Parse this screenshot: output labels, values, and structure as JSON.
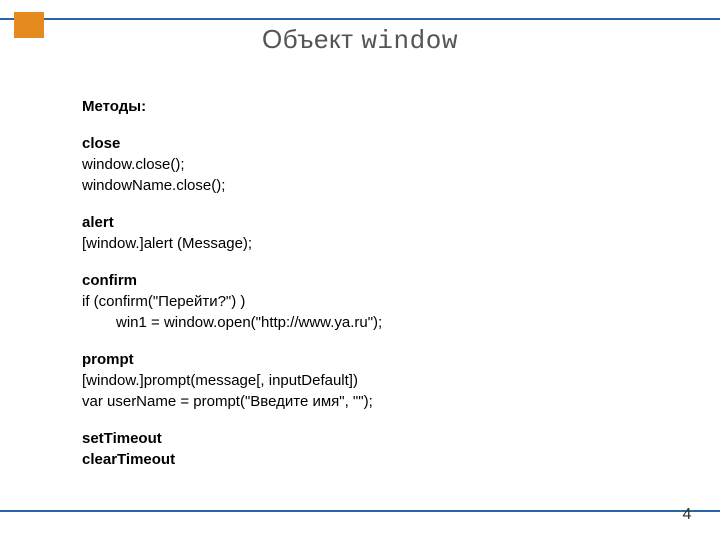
{
  "title_part1": "Объект ",
  "title_part2": "window",
  "lines": {
    "methods_heading": "Методы:",
    "close_h": "close",
    "close_l1": "window.close();",
    "close_l2": "windowName.close();",
    "alert_h": "alert",
    "alert_l1": "[window.]alert (Message);",
    "confirm_h": "confirm",
    "confirm_l1": "if (confirm(\"Перейти?\") )",
    "confirm_l2": "win1 = window.open(\"http://www.ya.ru\");",
    "prompt_h": "prompt",
    "prompt_l1": "[window.]prompt(message[, inputDefault])",
    "prompt_l2": "var userName = prompt(\"Введите имя\", \"\");",
    "settimeout_h": "setTimeout",
    "cleartimeout_h": "clearTimeout"
  },
  "page_number": "4"
}
